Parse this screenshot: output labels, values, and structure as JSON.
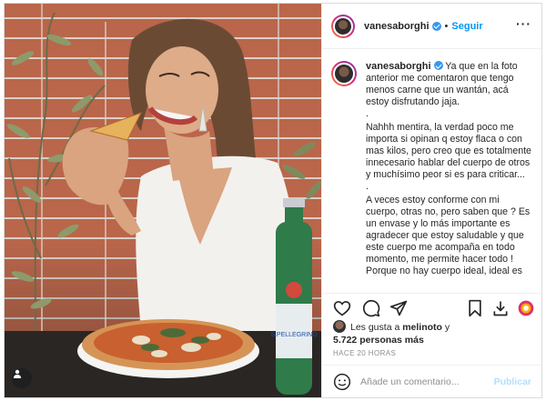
{
  "post": {
    "username": "vanesaborghi",
    "follow_label": "Seguir",
    "separator": "•",
    "more_label": "···",
    "caption_paragraphs": [
      "Ya que en la foto anterior me comentaron que tengo menos carne que un wantán, acá estoy disfrutando jaja.",
      ".",
      "Nahhh mentira, la verdad poco me importa si opinan q estoy flaca o con mas kilos, pero creo que es totalmente innecesario hablar del cuerpo de otros y muchísimo peor si es para criticar...",
      ".",
      "A veces estoy conforme con mi cuerpo, otras no, pero saben que ? Es un envase y lo más importante es agradecer que estoy saludable y que este cuerpo me acompaña en todo momento, me permite hacer todo !",
      "Porque no hay cuerpo ideal, ideal es"
    ],
    "liked_by_prefix": "Les gusta a ",
    "liked_by_user": "melinoto",
    "liked_by_suffix": " y",
    "likes_count": "5.722 personas más",
    "timestamp": "HACE 20 HORAS",
    "comment_placeholder": "Añade un comentario...",
    "publish_label": "Publicar"
  },
  "photo": {
    "bottle_label": "S.PELLEGRINO"
  },
  "icons": {
    "like": "heart-icon",
    "comment": "comment-icon",
    "share": "paper-plane-icon",
    "save": "bookmark-icon",
    "download": "download-icon",
    "extension": "extension-icon",
    "emoji": "emoji-icon",
    "user_tag": "user-tag-icon",
    "verified": "verified-badge-icon"
  },
  "colors": {
    "accent": "#0095f6",
    "publish_disabled": "#b2dffc",
    "verified": "#3897f0",
    "border": "#dbdbdb",
    "muted": "#8e8e8e"
  }
}
